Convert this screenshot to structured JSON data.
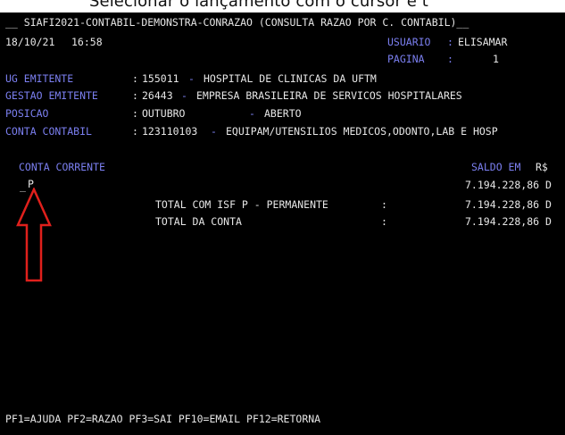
{
  "caption": "Selecionar o lançamento com o cursor e t",
  "header": {
    "title_line": "__ SIAFI2021-CONTABIL-DEMONSTRA-CONRAZAO (CONSULTA RAZAO POR C. CONTABIL)__",
    "date": "18/10/21",
    "time": "16:58",
    "usuario_label": "USUARIO",
    "usuario_value": "ELISAMAR",
    "pagina_label": "PAGINA",
    "pagina_value": "1"
  },
  "fields": {
    "ug_label": "UG EMITENTE",
    "ug_code": "155011",
    "ug_name": "HOSPITAL DE CLINICAS DA UFTM",
    "gestao_label": "GESTAO EMITENTE",
    "gestao_code": "26443",
    "gestao_name": "EMPRESA BRASILEIRA DE SERVICOS HOSPITALARES",
    "posicao_label": "POSICAO",
    "posicao_value": "OUTUBRO",
    "posicao_status": "ABERTO",
    "conta_label": "CONTA CONTABIL",
    "conta_code": "123110103",
    "conta_name": "EQUIPAM/UTENSILIOS MEDICOS,ODONTO,LAB E HOSP"
  },
  "table": {
    "col_conta": "CONTA CORRENTE",
    "col_saldo": "SALDO EM",
    "currency": "R$",
    "row_cursor": "_",
    "row_code": "P",
    "row_value": "7.194.228,86 D",
    "total_isf_label": "TOTAL COM ISF P - PERMANENTE",
    "total_isf_value": "7.194.228,86 D",
    "total_conta_label": "TOTAL DA CONTA",
    "total_conta_value": "7.194.228,86 D",
    "colon": ":"
  },
  "footer": "PF1=AJUDA PF2=RAZAO PF3=SAI PF10=EMAIL PF12=RETORNA",
  "colors": {
    "background": "#000000",
    "text": "#e6e6e6",
    "label": "#7b7ff0",
    "arrow": "#e0201c"
  }
}
